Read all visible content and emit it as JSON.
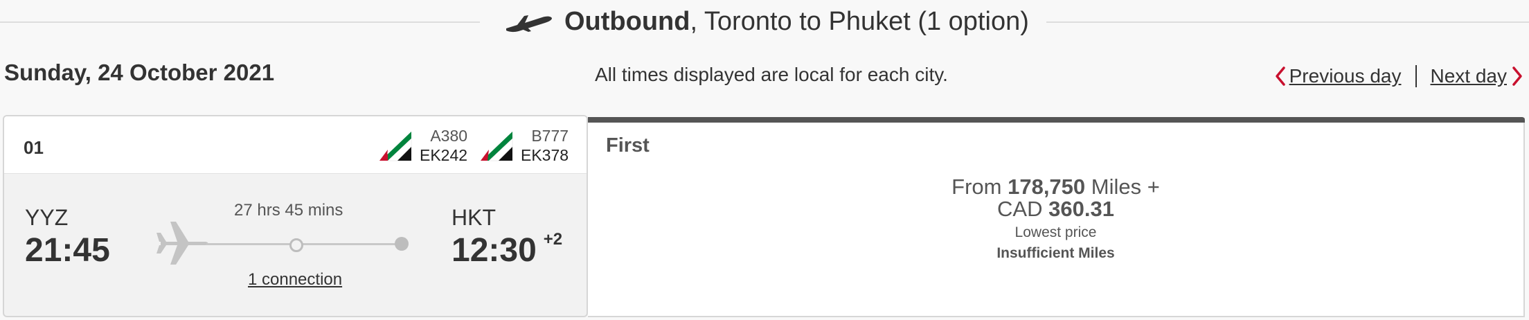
{
  "header": {
    "direction": "Outbound",
    "route": ", Toronto to Phuket (1 option)",
    "icon": "plane-takeoff-icon"
  },
  "date_label": "Sunday, 24 October 2021",
  "notice": "All times displayed are local for each city.",
  "day_nav": {
    "previous_label": "Previous day",
    "next_label": "Next day",
    "accent": "#c8102e"
  },
  "option": {
    "number": "01",
    "flights": [
      {
        "aircraft": "A380",
        "flight_number": "EK242",
        "icon": "emirates-tail-icon"
      },
      {
        "aircraft": "B777",
        "flight_number": "EK378",
        "icon": "emirates-tail-icon"
      }
    ],
    "departure": {
      "code": "YYZ",
      "time": "21:45"
    },
    "arrival": {
      "code": "HKT",
      "time": "12:30",
      "day_offset": "+2"
    },
    "duration": "27 hrs 45 mins",
    "connections": "1 connection"
  },
  "fare": {
    "cabin": "First",
    "from_label": "From",
    "miles": "178,750",
    "miles_label": "Miles +",
    "currency": "CAD",
    "cash": "360.31",
    "lowest_label": "Lowest price",
    "status": "Insufficient Miles"
  }
}
